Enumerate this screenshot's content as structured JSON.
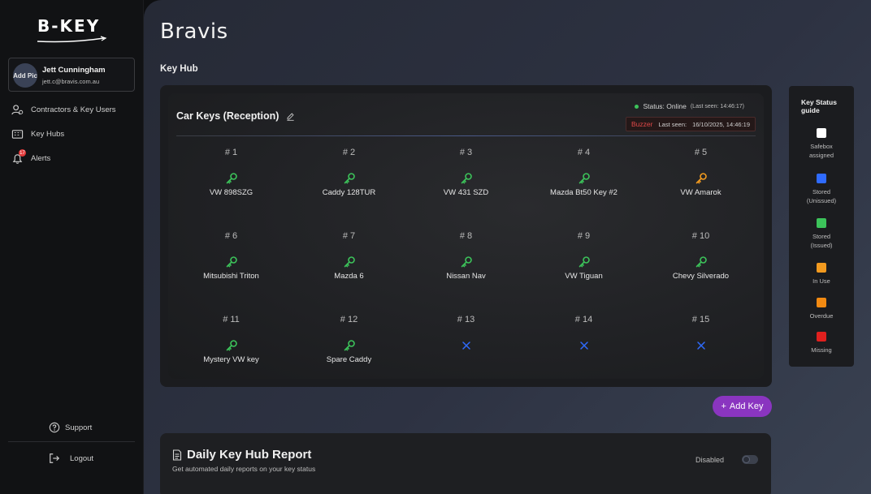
{
  "brand": {
    "logo_text": "B-KEY"
  },
  "user": {
    "avatar_text": "Add Pic",
    "name": "Jett Cunningham",
    "email": "jett.c@bravis.com.au"
  },
  "sidebar": {
    "items": [
      {
        "label": "Contractors & Key Users",
        "icon": "users-icon"
      },
      {
        "label": "Key Hubs",
        "icon": "key-hub-icon"
      },
      {
        "label": "Alerts",
        "icon": "bell-icon",
        "badge": "17"
      }
    ],
    "support_label": "Support",
    "logout_label": "Logout"
  },
  "page": {
    "title": "Bravis",
    "section_title": "Key Hub"
  },
  "hub": {
    "name": "Car Keys (Reception)",
    "status_text": "Status: Online",
    "last_seen": "(Last seen: 14:46:17)",
    "buzzer_label": "Buzzer",
    "buzzer_last_seen_label": "Last seen:",
    "buzzer_last_seen": "16/10/2025, 14:46:19",
    "colors": {
      "green": "#3cc35a",
      "orange": "#f29a1f",
      "blue": "#2f6bff",
      "red": "#e33a3a",
      "purple": "#8a35c0"
    },
    "slots": [
      {
        "num": "# 1",
        "label": "VW 898SZG",
        "state": "green"
      },
      {
        "num": "# 2",
        "label": "Caddy 128TUR",
        "state": "green"
      },
      {
        "num": "# 3",
        "label": "VW 431 SZD",
        "state": "green"
      },
      {
        "num": "# 4",
        "label": "Mazda Bt50 Key #2",
        "state": "green"
      },
      {
        "num": "# 5",
        "label": "VW Amarok",
        "state": "orange"
      },
      {
        "num": "# 6",
        "label": "Mitsubishi Triton",
        "state": "green"
      },
      {
        "num": "# 7",
        "label": "Mazda 6",
        "state": "green"
      },
      {
        "num": "# 8",
        "label": "Nissan Nav",
        "state": "green"
      },
      {
        "num": "# 9",
        "label": "VW Tiguan",
        "state": "green"
      },
      {
        "num": "# 10",
        "label": "Chevy Silverado",
        "state": "green"
      },
      {
        "num": "# 11",
        "label": "Mystery VW key",
        "state": "green"
      },
      {
        "num": "# 12",
        "label": "Spare Caddy",
        "state": "green"
      },
      {
        "num": "# 13",
        "label": "",
        "state": "empty"
      },
      {
        "num": "# 14",
        "label": "",
        "state": "empty"
      },
      {
        "num": "# 15",
        "label": "",
        "state": "empty"
      }
    ]
  },
  "add_key": {
    "label": "Add Key"
  },
  "legend": {
    "title": "Key Status guide",
    "items": [
      {
        "label_1": "Safebox",
        "label_2": "assigned",
        "color": "#ffffff"
      },
      {
        "label_1": "Stored",
        "label_2": "(Unissued)",
        "color": "#2f6bff"
      },
      {
        "label_1": "Stored",
        "label_2": "(Issued)",
        "color": "#3cc35a"
      },
      {
        "label_1": "In Use",
        "label_2": "",
        "color": "#f29a1f"
      },
      {
        "label_1": "Overdue",
        "label_2": "",
        "color": "#f28a12"
      },
      {
        "label_1": "Missing",
        "label_2": "",
        "color": "#e0201e"
      }
    ]
  },
  "report": {
    "title": "Daily Key Hub Report",
    "subtitle": "Get automated daily reports on your key status",
    "status": "Disabled"
  }
}
